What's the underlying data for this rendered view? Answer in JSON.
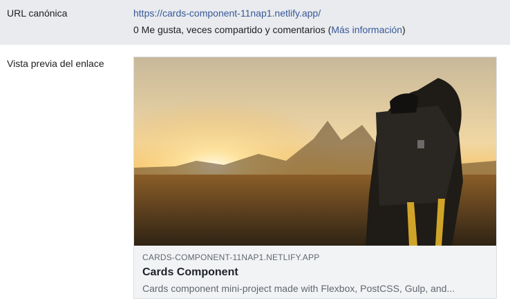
{
  "url_row": {
    "label": "URL canónica",
    "url": "https://cards-component-11nap1.netlify.app/",
    "engagement_prefix": "0 Me gusta, veces compartido y comentarios (",
    "more_info_link": "Más información",
    "engagement_suffix": ")"
  },
  "preview_row": {
    "label": "Vista previa del enlace",
    "card": {
      "domain": "CARDS-COMPONENT-11NAP1.NETLIFY.APP",
      "title": "Cards Component",
      "description": "Cards component mini-project made with Flexbox, PostCSS, Gulp, and..."
    }
  }
}
